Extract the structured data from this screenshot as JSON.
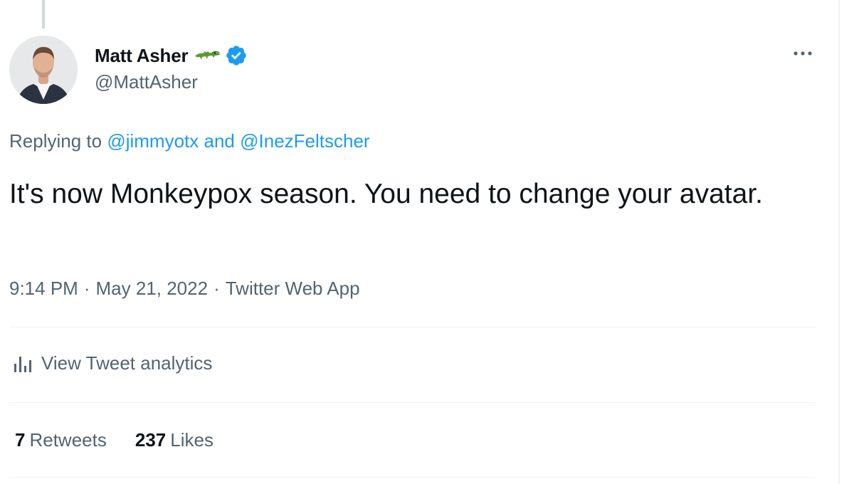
{
  "author": {
    "display_name": "Matt Asher",
    "handle": "@MattAsher",
    "name_emoji": "crocodile-icon",
    "verified_color": "#1d9bf0"
  },
  "reply": {
    "prefix": "Replying to",
    "mention_1": "@jimmyotx",
    "conjunction": "and",
    "mention_2": "@InezFeltscher"
  },
  "tweet": {
    "text": "It's now Monkeypox season. You need to change your avatar."
  },
  "meta": {
    "time": "9:14 PM",
    "separator": "·",
    "date": "May 21, 2022",
    "source": "Twitter Web App"
  },
  "analytics": {
    "label": "View Tweet analytics"
  },
  "stats": {
    "retweets_count": "7",
    "retweets_label": "Retweets",
    "likes_count": "237",
    "likes_label": "Likes"
  },
  "colors": {
    "link": "#1d9bf0",
    "secondary_text": "#536471",
    "primary_text": "#0f1419",
    "divider": "#eff3f4"
  }
}
